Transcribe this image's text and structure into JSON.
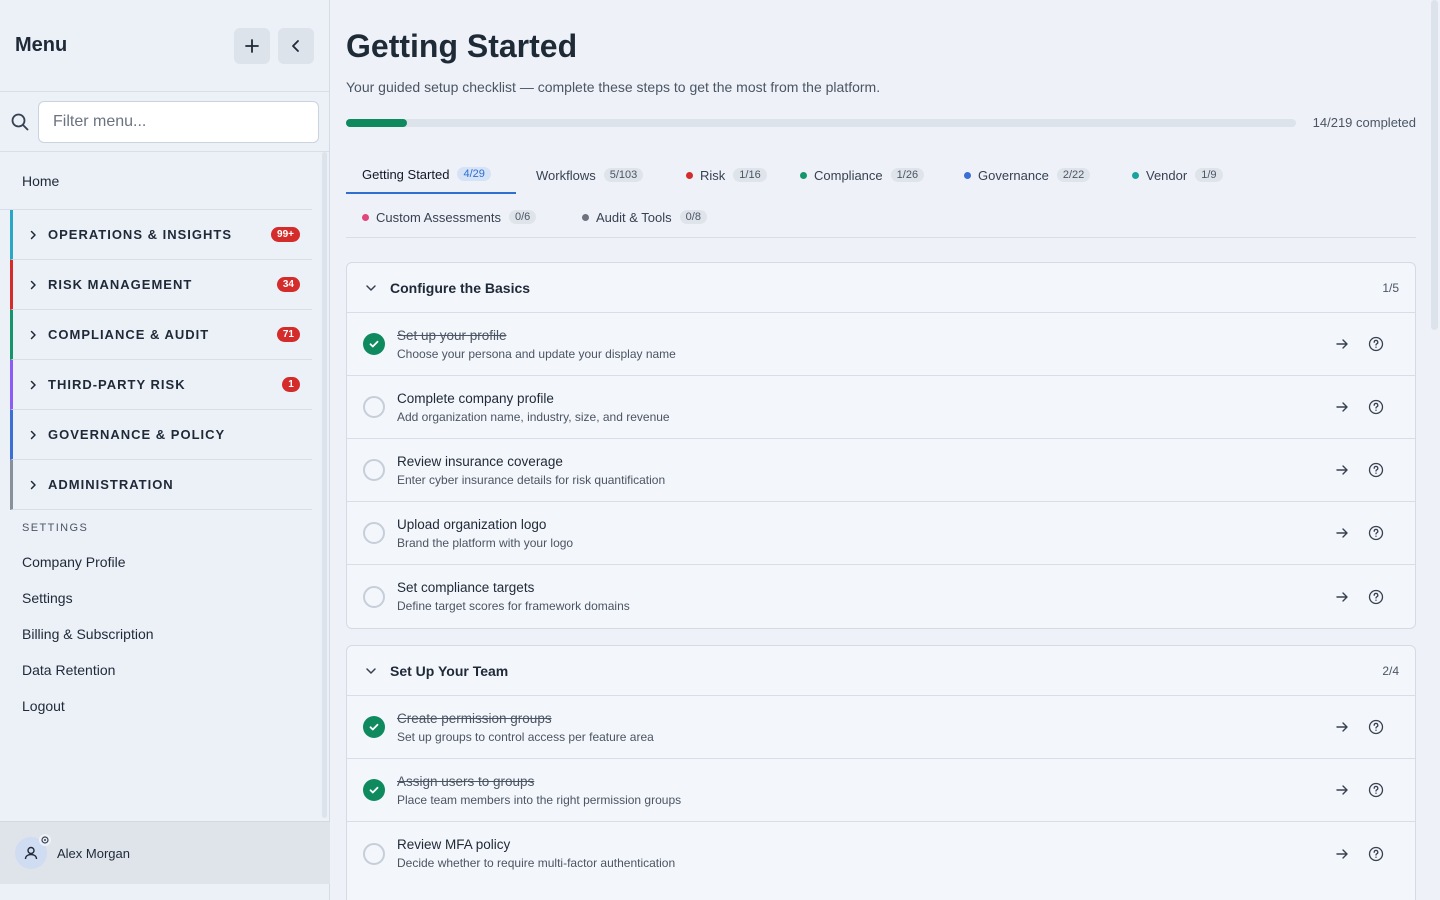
{
  "sidebar": {
    "title": "Menu",
    "filter_placeholder": "Filter menu...",
    "home": "Home",
    "sections": [
      {
        "label": "OPERATIONS & INSIGHTS",
        "badge": "99+",
        "color": "#2aa7c4"
      },
      {
        "label": "RISK MANAGEMENT",
        "badge": "34",
        "color": "#d42b2b"
      },
      {
        "label": "COMPLIANCE & AUDIT",
        "badge": "71",
        "color": "#15966a"
      },
      {
        "label": "THIRD-PARTY RISK",
        "badge": "1",
        "color": "#8b5cf6"
      },
      {
        "label": "GOVERNANCE & POLICY",
        "badge": "",
        "color": "#3b6fd6"
      },
      {
        "label": "ADMINISTRATION",
        "badge": "",
        "color": "#8a9099"
      }
    ],
    "settings_heading": "SETTINGS",
    "settings_links": [
      "Company Profile",
      "Settings",
      "Billing & Subscription",
      "Data Retention",
      "Logout"
    ],
    "user": "Alex Morgan"
  },
  "main": {
    "title": "Getting Started",
    "subtitle": "Your guided setup checklist — complete these steps to get the most from the platform.",
    "progress": {
      "completed": 14,
      "total": 219,
      "label": "14/219 completed"
    },
    "tabs": [
      {
        "label": "Getting Started",
        "count": "4/29",
        "active": true,
        "dot": ""
      },
      {
        "label": "Workflows",
        "count": "5/103",
        "dot": ""
      },
      {
        "label": "Risk",
        "count": "1/16",
        "dot": "#d42b2b"
      },
      {
        "label": "Compliance",
        "count": "1/26",
        "dot": "#15966a"
      },
      {
        "label": "Governance",
        "count": "2/22",
        "dot": "#3b6fd6"
      },
      {
        "label": "Vendor",
        "count": "1/9",
        "dot": "#1aa39a"
      },
      {
        "label": "Custom Assessments",
        "count": "0/6",
        "dot": "#e0457b"
      },
      {
        "label": "Audit & Tools",
        "count": "0/8",
        "dot": "#6b7280"
      }
    ],
    "groups": [
      {
        "title": "Configure the Basics",
        "count": "1/5",
        "items": [
          {
            "title": "Set up your profile",
            "desc": "Choose your persona and update your display name",
            "done": true
          },
          {
            "title": "Complete company profile",
            "desc": "Add organization name, industry, size, and revenue",
            "done": false
          },
          {
            "title": "Review insurance coverage",
            "desc": "Enter cyber insurance details for risk quantification",
            "done": false
          },
          {
            "title": "Upload organization logo",
            "desc": "Brand the platform with your logo",
            "done": false
          },
          {
            "title": "Set compliance targets",
            "desc": "Define target scores for framework domains",
            "done": false
          }
        ]
      },
      {
        "title": "Set Up Your Team",
        "count": "2/4",
        "items": [
          {
            "title": "Create permission groups",
            "desc": "Set up groups to control access per feature area",
            "done": true
          },
          {
            "title": "Assign users to groups",
            "desc": "Place team members into the right permission groups",
            "done": true
          },
          {
            "title": "Review MFA policy",
            "desc": "Decide whether to require multi-factor authentication",
            "done": false
          }
        ]
      }
    ]
  },
  "icons": {
    "add": "plus-icon",
    "collapse": "chevron-left-icon",
    "search": "search-icon",
    "open": "arrow-right-icon",
    "help": "help-circle-icon"
  }
}
